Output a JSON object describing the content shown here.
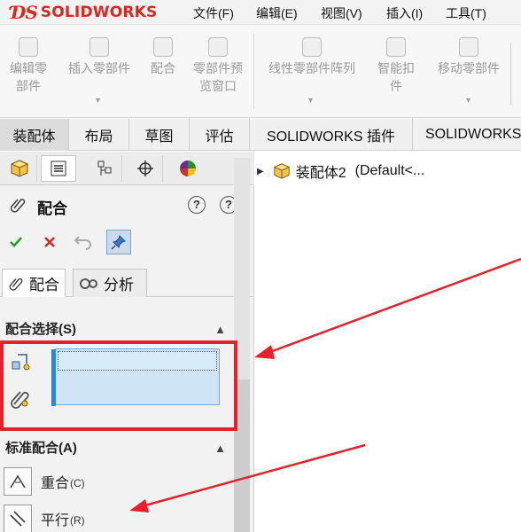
{
  "app": {
    "logo_ds": "ƊS",
    "logo_text": "SOLIDWORKS"
  },
  "menu": {
    "items": [
      "文件(F)",
      "编辑(E)",
      "视图(V)",
      "插入(I)",
      "工具(T)"
    ]
  },
  "ribbon": {
    "buttons": [
      {
        "line1": "编辑零",
        "line2": "部件",
        "icon": "edit-component-icon"
      },
      {
        "line1": "插入零部件",
        "line2": "",
        "icon": "insert-component-icon"
      },
      {
        "line1": "配合",
        "line2": "",
        "icon": "mate-paperclip-icon"
      },
      {
        "line1": "零部件预",
        "line2": "览窗口",
        "icon": "component-preview-icon"
      },
      {
        "line1": "线性零部件阵列",
        "line2": "",
        "icon": "linear-pattern-icon"
      },
      {
        "line1": "智能扣",
        "line2": "件",
        "icon": "smart-fastener-icon"
      },
      {
        "line1": "移动零部件",
        "line2": "",
        "icon": "move-component-icon"
      }
    ]
  },
  "tabs": [
    "装配体",
    "布局",
    "草图",
    "评估",
    "SOLIDWORKS 插件",
    "SOLIDWORKS"
  ],
  "property_manager": {
    "title": "配合",
    "help_label": "?",
    "help2_label": "?",
    "subtabs": [
      "配合",
      "分析"
    ],
    "groups": {
      "mate_selections": "配合选择(S)",
      "standard_mates": "标准配合(A)"
    },
    "mates": [
      {
        "label": "重合",
        "key": "(C)",
        "icon": "coincident-icon"
      },
      {
        "label": "平行",
        "key": "(R)",
        "icon": "parallel-icon"
      }
    ],
    "colors": {
      "accept": "#23a023",
      "cancel": "#d9261c",
      "highlight": "#e8202a",
      "selection": "#cfe5f6"
    }
  },
  "tree": {
    "assembly_name": "装配体2",
    "configuration": "(Default<..."
  }
}
